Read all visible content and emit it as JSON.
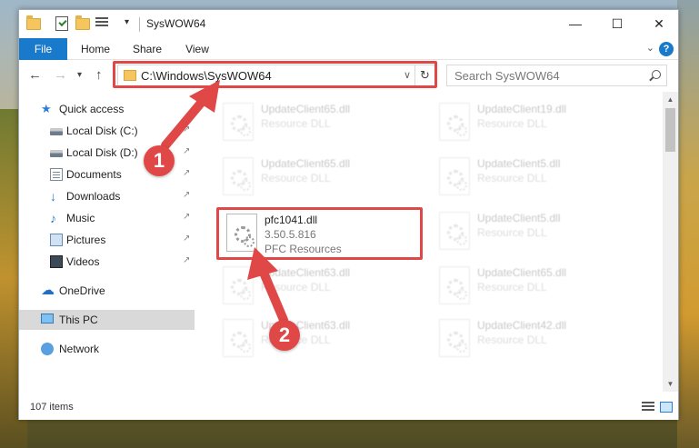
{
  "window": {
    "title": "SysWOW64",
    "minimize": "—",
    "maximize": "☐",
    "close": "✕",
    "qa_dropdown": "▾"
  },
  "ribbon": {
    "tabs": [
      {
        "label": "File"
      },
      {
        "label": "Home"
      },
      {
        "label": "Share"
      },
      {
        "label": "View"
      }
    ],
    "chevron": "⌄",
    "help": "?"
  },
  "nav": {
    "back": "←",
    "forward": "→",
    "recent": "▾",
    "up": "↑",
    "address": "C:\\Windows\\SysWOW64",
    "address_dropdown": "∨",
    "refresh": "↻",
    "search_placeholder": "Search SysWOW64"
  },
  "sidebar": {
    "pin_glyph": "↗",
    "items": [
      {
        "label": "Quick access"
      },
      {
        "label": "Local Disk (C:)"
      },
      {
        "label": "Local Disk (D:)"
      },
      {
        "label": "Documents"
      },
      {
        "label": "Downloads"
      },
      {
        "label": "Music"
      },
      {
        "label": "Pictures"
      },
      {
        "label": "Videos"
      },
      {
        "label": "OneDrive"
      },
      {
        "label": "This PC"
      },
      {
        "label": "Network"
      }
    ]
  },
  "files": {
    "col1": [
      {
        "name": "UpdateClient65.dll",
        "type": "Resource DLL"
      },
      {
        "name": "UpdateClient65.dll",
        "type": "Resource DLL"
      },
      {
        "name": "pfc1041.dll",
        "version": "3.50.5.816",
        "description": "PFC Resources"
      },
      {
        "name": "UpdateClient63.dll",
        "type": "Resource DLL"
      },
      {
        "name": "UpdateClient63.dll",
        "type": "Resource DLL"
      }
    ],
    "col2": [
      {
        "name": "UpdateClient19.dll",
        "type": "Resource DLL"
      },
      {
        "name": "UpdateClient5.dll",
        "type": "Resource DLL"
      },
      {
        "name": "UpdateClient5.dll",
        "type": "Resource DLL"
      },
      {
        "name": "UpdateClient65.dll",
        "type": "Resource DLL"
      },
      {
        "name": "UpdateClient42.dll",
        "type": "Resource DLL"
      }
    ]
  },
  "scrollbar": {
    "up": "▲",
    "down": "▼"
  },
  "status": {
    "items_count": "107 items"
  },
  "annotations": {
    "step1": "1",
    "step2": "2"
  },
  "colors": {
    "accent": "#1979ca",
    "annotation": "#e04848"
  }
}
